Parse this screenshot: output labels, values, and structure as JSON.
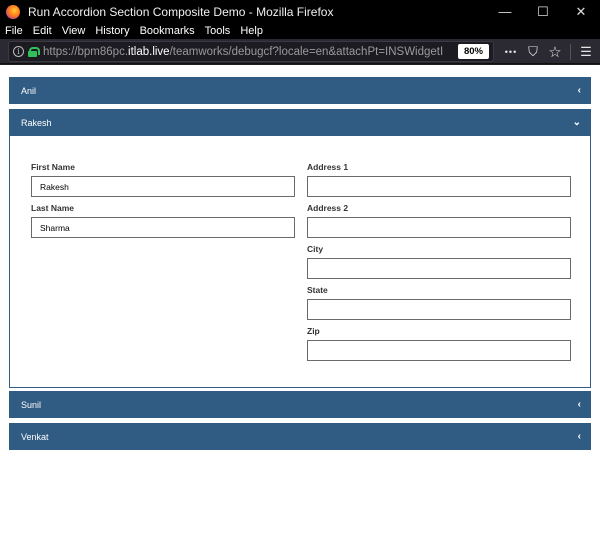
{
  "window": {
    "title": "Run Accordion Section Composite Demo - Mozilla Firefox",
    "controls": {
      "minimize": "—",
      "maximize": "☐",
      "close": "✕"
    }
  },
  "menu": [
    "File",
    "Edit",
    "View",
    "History",
    "Bookmarks",
    "Tools",
    "Help"
  ],
  "navbar": {
    "url_prefix": "https://bpm86pc.",
    "url_domain": "itlab.live",
    "url_suffix": "/teamworks/debugcf?locale=en&attachPt=INSWidgetID&contai",
    "zoom": "80%",
    "tools": {
      "more": "•••",
      "pocket": "⛉",
      "star": "☆",
      "menu": "☰"
    }
  },
  "accordion": {
    "sections": [
      {
        "label": "Anil",
        "chevron": "‹"
      },
      {
        "label": "Rakesh",
        "chevron": "⌄"
      },
      {
        "label": "Sunil",
        "chevron": "‹"
      },
      {
        "label": "Venkat",
        "chevron": "‹"
      }
    ],
    "form": {
      "first_name": {
        "label": "First Name",
        "value": "Rakesh"
      },
      "last_name": {
        "label": "Last Name",
        "value": "Sharma"
      },
      "address1": {
        "label": "Address 1",
        "value": ""
      },
      "address2": {
        "label": "Address 2",
        "value": ""
      },
      "city": {
        "label": "City",
        "value": ""
      },
      "state": {
        "label": "State",
        "value": ""
      },
      "zip": {
        "label": "Zip",
        "value": ""
      }
    }
  },
  "colors": {
    "accent": "#305b82"
  }
}
